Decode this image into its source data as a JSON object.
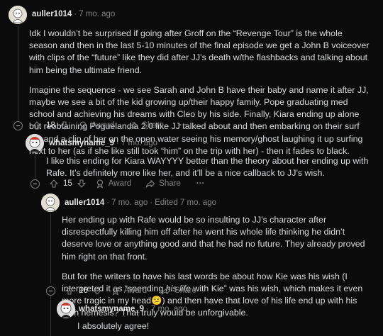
{
  "comments": [
    {
      "username": "auller1014",
      "age": "7 mo. ago",
      "edited": "",
      "paragraphs": [
        "Idk I wouldn’t be surprised if going after Groff on the “Revenge Tour” is the whole season and then in the last 5-10 minutes of the final episode we get a John B voiceover with clips of the “future” like they did after JJ’s death w/the flashbacks and talking about him being the ultimate friend.",
        "Imagine the sequence - we see Sarah and John B have their baby and name it after JJ, maybe we see a bit of the kid growing up/their happy family. Pope graduating med school and achieving his dreams with Cleo by his side. Finally, Kiara ending up alone but reobtaining Poguelandia 2.0 like JJ talked about and then embarking on their surf trip and a clip of her on the open water seeing his memory/ghost laughing it up surfing next to her (as if she like still took “him” on the trip with her) - then it fades to black."
      ],
      "score": "18",
      "award_label": "Award",
      "share_label": "Share",
      "more_label": "···"
    },
    {
      "username": "whatsmyname_9",
      "age": "7 mo. ago",
      "edited": "",
      "paragraphs": [
        "I like this ending for Kiara WAYYYY better than the theory about her ending up with Rafe. It’s definitely more like her, and it’ll be a nice callback to JJ’s wish."
      ],
      "score": "15",
      "award_label": "Award",
      "share_label": "Share",
      "more_label": "···"
    },
    {
      "username": "auller1014",
      "age": "7 mo. ago",
      "edited": "Edited 7 mo. ago",
      "paragraphs": [
        "Her ending up with Rafe would be so insulting to JJ’s character after disrespectfully killing him off after he went his whole life thinking he didn’t deserve love or anything good and that he had no future. They already proved him right on that front."
      ],
      "p2_before": "But for the writers to have his last words be about how Kie was his wish (I interpreted it as “spending ",
      "p2_em": "his life",
      "p2_mid": " with Kie” was his wish, which makes it even more tragic in my head",
      "p2_emoji": "😕",
      "p2_after": ") and then have that love of his life end up with his arch nemesis? That truly would be unforgivable.",
      "score": "16",
      "award_label": "Award",
      "share_label": "Share",
      "more_label": "···"
    },
    {
      "username": "whatsmyname_9",
      "age": "7 mo. ago",
      "edited": "",
      "paragraphs": [
        "I absolutely agree!"
      ]
    }
  ],
  "icons": {
    "upvote": "arrow-up-icon",
    "downvote": "arrow-down-icon",
    "award": "award-icon",
    "share": "share-icon",
    "collapse": "collapse-minus-icon"
  },
  "colors": {
    "background": "#0b0b0b",
    "text": "#d7dadc",
    "muted": "#818384",
    "thread_line": "#343536"
  }
}
